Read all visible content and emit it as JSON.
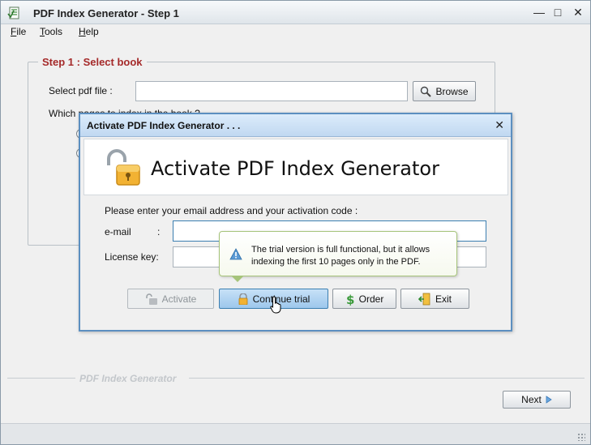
{
  "window": {
    "title": "PDF Index Generator - Step 1",
    "controls": {
      "minimize": "—",
      "maximize": "□",
      "close": "✕"
    }
  },
  "menu": {
    "items": [
      {
        "label": "File",
        "mnemonic": "F",
        "rest": "ile"
      },
      {
        "label": "Tools",
        "mnemonic": "T",
        "rest": "ools"
      },
      {
        "label": "Help",
        "mnemonic": "H",
        "rest": "elp"
      }
    ]
  },
  "step": {
    "title": "Step 1 : Select book",
    "select_label": "Select pdf file :",
    "file_value": "",
    "browse_label": "Browse",
    "pages_question": "Which pages to index in the book ?"
  },
  "footer": {
    "brand": "PDF Index Generator",
    "next_label": "Next"
  },
  "dialog": {
    "title": "Activate PDF Index Generator . . .",
    "close": "✕",
    "banner_heading": "Activate PDF Index Generator",
    "prompt": "Please enter your email address and your activation code :",
    "email_label": "e-mail",
    "email_colon": ":",
    "email_value": "",
    "license_label": "License key:",
    "license_value": "",
    "buttons": {
      "activate": "Activate",
      "continue_trial": "Continue trial",
      "order": "Order",
      "exit": "Exit"
    }
  },
  "tooltip": {
    "line1": "The trial version is full functional, but it allows",
    "line2": "indexing the first 10 pages only in the PDF."
  },
  "colors": {
    "group_title": "#a52a2a",
    "dialog_border": "#5c8fc0",
    "tooltip_border": "#a6c47a",
    "focused_input_border": "#3c7fb1",
    "continue_button_bg": "#a9cdee"
  }
}
